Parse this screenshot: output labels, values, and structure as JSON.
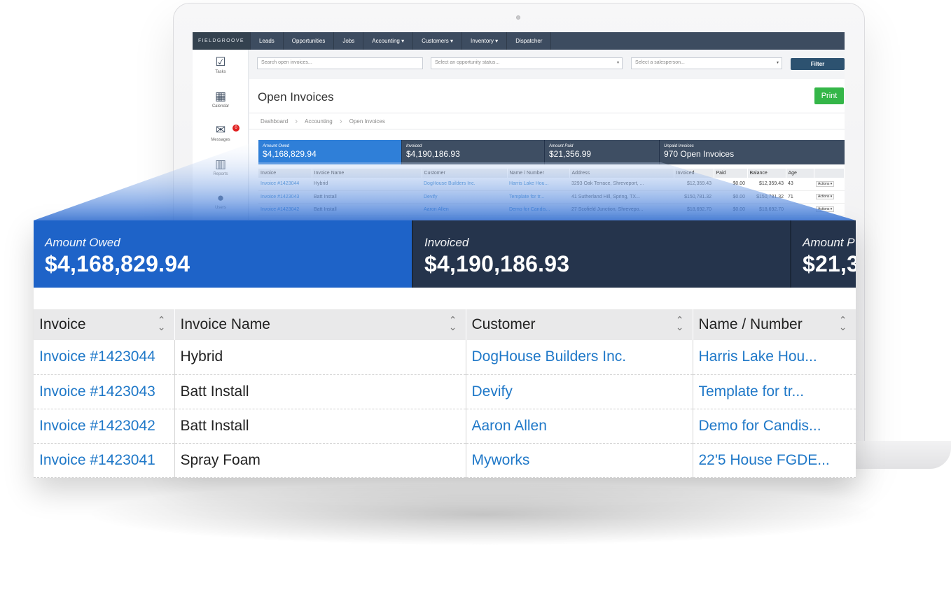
{
  "app": {
    "brand": "FIELDGROOVE",
    "nav": [
      "Leads",
      "Opportunities",
      "Jobs",
      "Accounting ▾",
      "Customers ▾",
      "Inventory ▾",
      "Dispatcher"
    ]
  },
  "sidebar": {
    "items": [
      {
        "label": "Tasks",
        "icon": "tasks-icon",
        "glyph": "☑"
      },
      {
        "label": "Calendar",
        "icon": "calendar-icon",
        "glyph": "▦"
      },
      {
        "label": "Messages",
        "icon": "envelope-icon",
        "glyph": "✉",
        "badge": "0"
      },
      {
        "label": "Reports",
        "icon": "bar-chart-icon",
        "glyph": "▥"
      },
      {
        "label": "Users",
        "icon": "users-icon",
        "glyph": "●"
      }
    ]
  },
  "filters": {
    "search_placeholder": "Search open invoices...",
    "status_placeholder": "Select an opportunity status...",
    "salesperson_placeholder": "Select a salesperson...",
    "filter_label": "Filter"
  },
  "page": {
    "title": "Open Invoices",
    "print_label": "Print",
    "breadcrumb": [
      "Dashboard",
      "Accounting",
      "Open Invoices"
    ]
  },
  "stats": [
    {
      "label": "Amount Owed",
      "value": "$4,168,829.94",
      "color": "#2f7fd8"
    },
    {
      "label": "Invoiced",
      "value": "$4,190,186.93",
      "color": "#3e4e63"
    },
    {
      "label": "Amount Paid",
      "value": "$21,356.99",
      "color": "#3e4e63"
    },
    {
      "label": "Unpaid Invoices",
      "value": "970 Open Invoices",
      "color": "#3e4e63"
    }
  ],
  "mini_table": {
    "headers": [
      "Invoice",
      "Invoice Name",
      "Customer",
      "Name / Number",
      "Address",
      "Invoiced",
      "Paid",
      "Balance",
      "Age",
      ""
    ],
    "rows": [
      [
        "Invoice #1423044",
        "Hybrid",
        "DogHouse Builders Inc.",
        "Harris Lake Hou...",
        "3293 Oak Terrace, Shreveport, ...",
        "$12,359.43",
        "$0.00",
        "$12,359.43",
        "43",
        "Actions ▾"
      ],
      [
        "Invoice #1423043",
        "Batt Install",
        "Devify",
        "Template for tr...",
        "41 Sutherland Hill, Spring, TX...",
        "$150,781.32",
        "$0.00",
        "$150,781.32",
        "71",
        "Actions ▾"
      ],
      [
        "Invoice #1423042",
        "Batt Install",
        "Aaron Allen",
        "Demo for Candis...",
        "27 Scofield Junction, Shrevepo...",
        "$18,692.70",
        "$0.00",
        "$18,692.70",
        "",
        "Actions ▾"
      ]
    ]
  },
  "zoom": {
    "stats": [
      {
        "label": "Amount Owed",
        "value": "$4,168,829.94",
        "color": "#1e63c8"
      },
      {
        "label": "Invoiced",
        "value": "$4,190,186.93",
        "color": "#25344c"
      },
      {
        "label": "Amount P",
        "value": "$21,3",
        "color": "#25344c"
      }
    ],
    "headers": [
      "Invoice",
      "Invoice Name",
      "Customer",
      "Name / Number"
    ],
    "rows": [
      [
        "Invoice #1423044",
        "Hybrid",
        "DogHouse Builders Inc.",
        "Harris Lake Hou..."
      ],
      [
        "Invoice #1423043",
        "Batt Install",
        "Devify",
        "Template for tr..."
      ],
      [
        "Invoice #1423042",
        "Batt Install",
        "Aaron Allen",
        "Demo for Candis..."
      ],
      [
        "Invoice #1423041",
        "Spray Foam",
        "Myworks",
        "22'5 House FGDE..."
      ]
    ]
  },
  "colors": {
    "nav_bg": "#3d4c60",
    "link": "#1f78c8",
    "print_green": "#34b648",
    "projection_blue": "#2f6fd6"
  }
}
